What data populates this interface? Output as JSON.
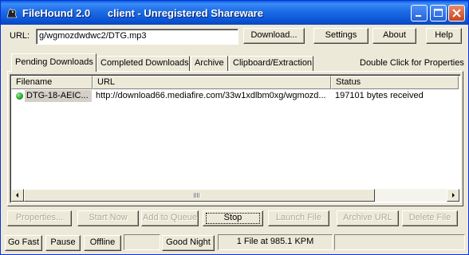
{
  "window": {
    "title": "FileHound 2.0      client - Unregistered Shareware"
  },
  "url_bar": {
    "label": "URL:",
    "value": "g/wgmozdwdwc2/DTG.mp3"
  },
  "toolbar": {
    "download": "Download...",
    "settings": "Settings",
    "about": "About",
    "help": "Help"
  },
  "tabs": [
    {
      "label": "Pending Downloads",
      "active": true
    },
    {
      "label": "Completed Downloads",
      "active": false
    },
    {
      "label": "Archive",
      "active": false
    },
    {
      "label": "Clipboard/Extraction",
      "active": false
    }
  ],
  "tab_hint": "Double Click for Properties",
  "table": {
    "columns": [
      "Filename",
      "URL",
      "Status"
    ],
    "rows": [
      {
        "filename": "DTG-18-AEIC...",
        "url": "http://download66.mediafire.com/33w1xdlbm0xg/wgmozd...",
        "status": "197101 bytes received",
        "status_color": "#22a322"
      }
    ]
  },
  "actions": {
    "properties": "Properties...",
    "start_now": "Start Now",
    "add_to_queue": "Add to Queue",
    "stop": "Stop",
    "launch_file": "Launch File",
    "archive_url": "Archive URL",
    "delete_file": "Delete File"
  },
  "statusbar": {
    "go_fast": "Go Fast",
    "pause": "Pause",
    "offline": "Offline",
    "good_night": "Good Night",
    "info": "1 File at 985.1 KPM"
  },
  "colors": {
    "titlebar": "#0a52d4",
    "face": "#ece9d8"
  }
}
